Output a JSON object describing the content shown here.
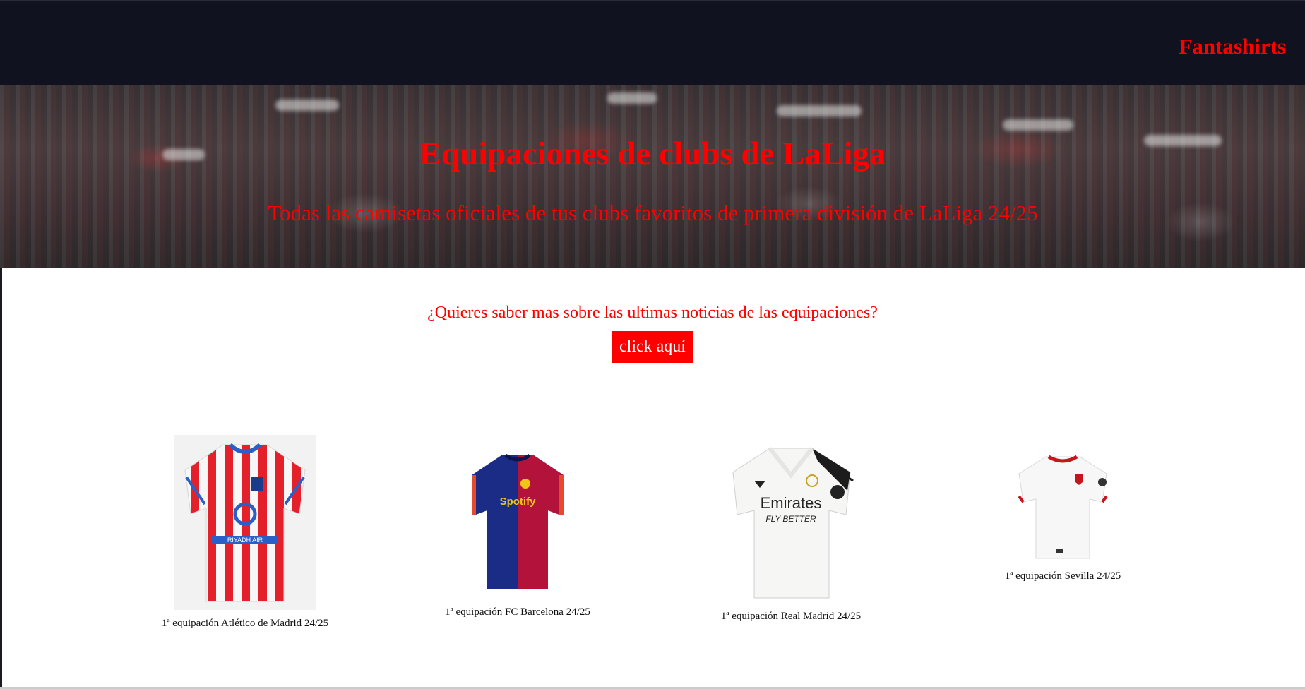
{
  "header": {
    "brand": "Fantashirts"
  },
  "hero": {
    "title": "Equipaciones de clubs de LaLiga",
    "subtitle": "Todas las camisetas oficiales de tus clubs favoritos de primera división de LaLiga 24/25"
  },
  "news": {
    "question": "¿Quieres saber mas sobre las ultimas noticias de las equipaciones?",
    "button_label": "click aquí"
  },
  "products": [
    {
      "caption": "1ª equipación Atlético de Madrid 24/25",
      "icon": "atletico-jersey-icon"
    },
    {
      "caption": "1ª equipación FC Barcelona 24/25",
      "icon": "barcelona-jersey-icon"
    },
    {
      "caption": "1ª equipación Real Madrid 24/25",
      "icon": "real-madrid-jersey-icon"
    },
    {
      "caption": "1ª equipación Sevilla 24/25",
      "icon": "sevilla-jersey-icon"
    }
  ],
  "jersey_text": {
    "atletico_sponsor": "RIYADH AIR",
    "barcelona_sponsor": "Spotify",
    "real_sponsor": "Emirates",
    "real_slogan": "FLY BETTER"
  },
  "colors": {
    "accent": "#ff0000",
    "topbar": "#11121f"
  }
}
